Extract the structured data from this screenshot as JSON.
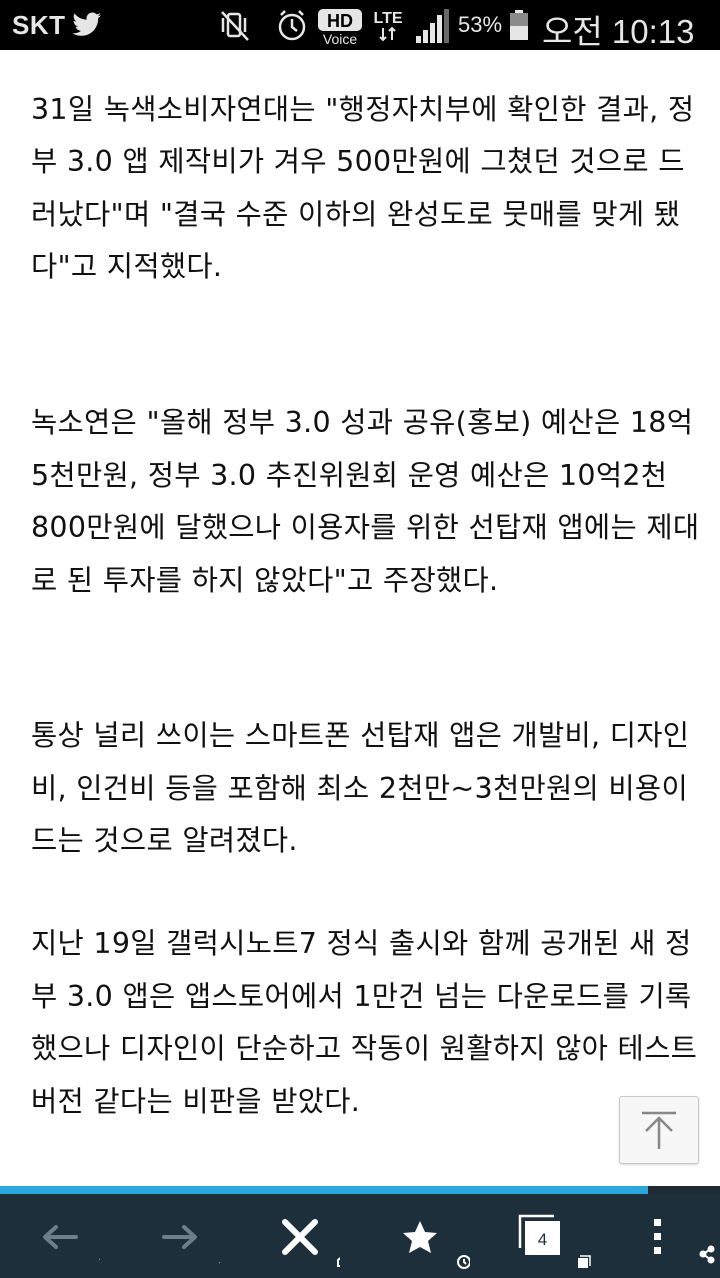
{
  "status_bar": {
    "carrier": "SKT",
    "hd_label": "HD",
    "voice_label": "Voice",
    "lte_label": "LTE",
    "battery_percent": "53%",
    "time": "오전 10:13"
  },
  "article": {
    "paragraphs": [
      "31일 녹색소비자연대는 \"행정자치부에 확인한 결과, 정부 3.0 앱 제작비가 겨우 500만원에 그쳤던 것으로 드러났다\"며 \"결국 수준 이하의 완성도로 뭇매를 맞게 됐다\"고 지적했다.",
      "녹소연은 \"올해 정부 3.0 성과 공유(홍보) 예산은 18억5천만원, 정부 3.0 추진위원회 운영 예산은 10억2천800만원에 달했으나 이용자를 위한 선탑재 앱에는 제대로 된 투자를 하지 않았다\"고 주장했다.",
      "통상 널리 쓰이는 스마트폰 선탑재 앱은 개발비, 디자인비, 인건비 등을 포함해 최소 2천만~3천만원의 비용이 드는 것으로 알려졌다.",
      "지난 19일 갤럭시노트7 정식 출시와 함께 공개된 새 정부 3.0 앱은 앱스토어에서 1만건 넘는 다운로드를 기록했으나 디자인이 단순하고 작동이 원활하지 않아 테스트 버전 같다는 비판을 받았다."
    ]
  },
  "page_progress": 0.9,
  "toolbar": {
    "tab_count": "4",
    "icons": [
      "back-arrow-icon",
      "forward-arrow-icon",
      "close-icon",
      "star-icon",
      "tabs-icon",
      "more-vertical-icon"
    ]
  },
  "colors": {
    "toolbar_bg": "#1e2f3c",
    "progress_fill": "#2aa8de",
    "text": "#111111"
  }
}
